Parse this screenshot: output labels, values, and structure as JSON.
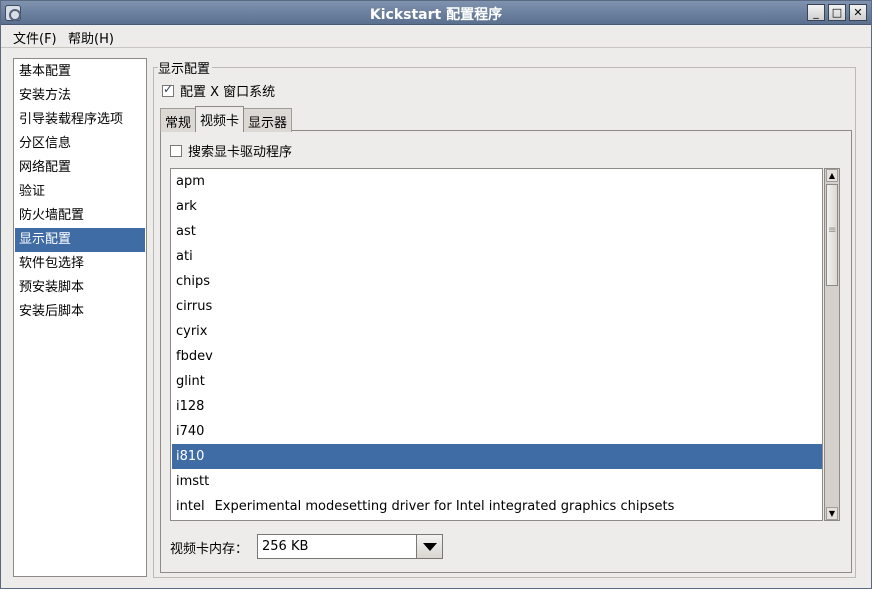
{
  "window": {
    "title": "Kickstart 配置程序",
    "buttons": {
      "minimize": "_",
      "maximize": "□",
      "close": "✕"
    }
  },
  "menubar": {
    "items": [
      "文件(F)",
      "帮助(H)"
    ]
  },
  "sidebar": {
    "items": [
      "基本配置",
      "安装方法",
      "引导装载程序选项",
      "分区信息",
      "网络配置",
      "验证",
      "防火墙配置",
      "显示配置",
      "软件包选择",
      "预安装脚本",
      "安装后脚本"
    ],
    "selected_index": 7
  },
  "display_config": {
    "group_label": "显示配置",
    "configure_x": {
      "label": "配置 X 窗口系统",
      "checked": true
    },
    "tabs": [
      "常规",
      "视频卡",
      "显示器"
    ],
    "active_tab": 1,
    "probe": {
      "label": "搜索显卡驱动程序",
      "checked": false
    },
    "drivers": [
      {
        "name": "apm",
        "desc": ""
      },
      {
        "name": "ark",
        "desc": ""
      },
      {
        "name": "ast",
        "desc": ""
      },
      {
        "name": "ati",
        "desc": ""
      },
      {
        "name": "chips",
        "desc": ""
      },
      {
        "name": "cirrus",
        "desc": ""
      },
      {
        "name": "cyrix",
        "desc": ""
      },
      {
        "name": "fbdev",
        "desc": ""
      },
      {
        "name": "glint",
        "desc": ""
      },
      {
        "name": "i128",
        "desc": ""
      },
      {
        "name": "i740",
        "desc": ""
      },
      {
        "name": "i810",
        "desc": ""
      },
      {
        "name": "imstt",
        "desc": ""
      },
      {
        "name": "intel",
        "desc": "Experimental modesetting driver for Intel integrated graphics chipsets"
      }
    ],
    "selected_driver_index": 11,
    "video_memory": {
      "label": "视频卡内存：",
      "value": "256 KB"
    }
  },
  "colors": {
    "selection": "#406ca6",
    "titlebar": "#6a7e9e"
  }
}
